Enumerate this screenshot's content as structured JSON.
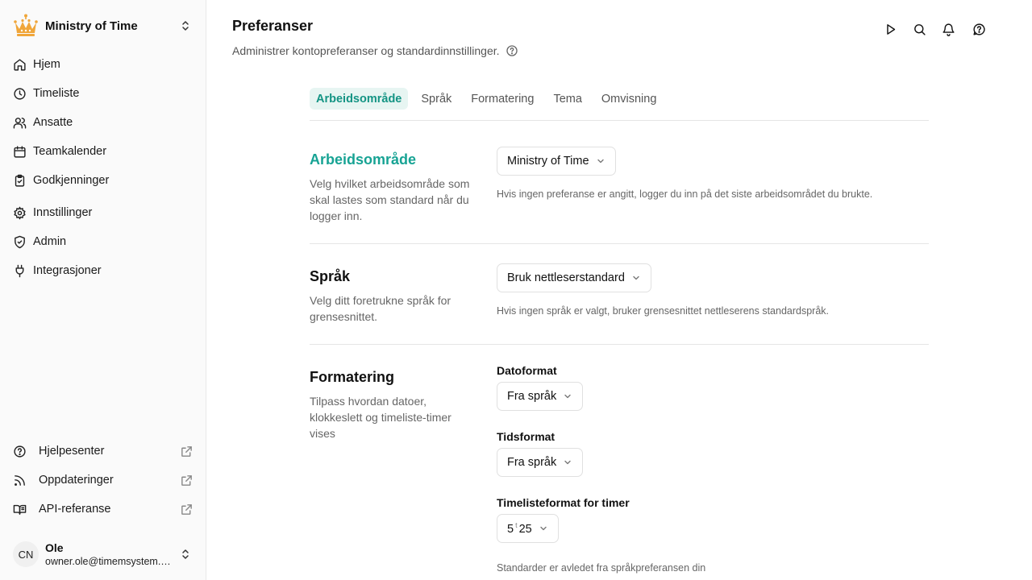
{
  "workspace": {
    "name": "Ministry of Time"
  },
  "sidebar": {
    "items": [
      {
        "label": "Hjem",
        "icon": "home-icon"
      },
      {
        "label": "Timeliste",
        "icon": "clock-icon"
      },
      {
        "label": "Ansatte",
        "icon": "users-icon"
      },
      {
        "label": "Teamkalender",
        "icon": "calendar-icon"
      },
      {
        "label": "Godkjenninger",
        "icon": "clipboard-check-icon"
      },
      {
        "label": "Innstillinger",
        "icon": "gear-icon"
      },
      {
        "label": "Admin",
        "icon": "shield-check-icon"
      },
      {
        "label": "Integrasjoner",
        "icon": "plug-icon"
      }
    ],
    "bottom": [
      {
        "label": "Hjelpesenter",
        "icon": "help-circle-icon"
      },
      {
        "label": "Oppdateringer",
        "icon": "rss-icon"
      },
      {
        "label": "API-referanse",
        "icon": "book-icon"
      }
    ]
  },
  "user": {
    "initials": "CN",
    "name": "Ole",
    "email": "owner.ole@timemsystem.com"
  },
  "header": {
    "title": "Preferanser",
    "subtitle": "Administrer kontopreferanser og standardinnstillinger."
  },
  "tabs": [
    "Arbeidsområde",
    "Språk",
    "Formatering",
    "Tema",
    "Omvisning"
  ],
  "sections": {
    "workspace": {
      "title": "Arbeidsområde",
      "description": "Velg hvilket arbeidsområde som skal lastes som standard når du logger inn.",
      "value": "Ministry of Time",
      "hint": "Hvis ingen preferanse er angitt, logger du inn på det siste arbeidsområdet du brukte."
    },
    "language": {
      "title": "Språk",
      "description": "Velg ditt foretrukne språk for grensesnittet.",
      "value": "Bruk nettleserstandard",
      "hint": "Hvis ingen språk er valgt, bruker grensesnittet nettleserens standardspråk."
    },
    "formatting": {
      "title": "Formatering",
      "description": "Tilpass hvordan datoer, klokkeslett og timeliste-timer vises",
      "date_label": "Datoformat",
      "date_value": "Fra språk",
      "time_label": "Tidsformat",
      "time_value": "Fra språk",
      "hours_label": "Timelisteformat for timer",
      "hours_value_main": "5",
      "hours_value_sup": "t",
      "hours_value_rest": "25",
      "hint": "Standarder er avledet fra språkpreferansen din"
    }
  },
  "colors": {
    "accent": "#17a394",
    "tab_active_bg": "#e7f5f2",
    "logo": "#f0a63a"
  }
}
